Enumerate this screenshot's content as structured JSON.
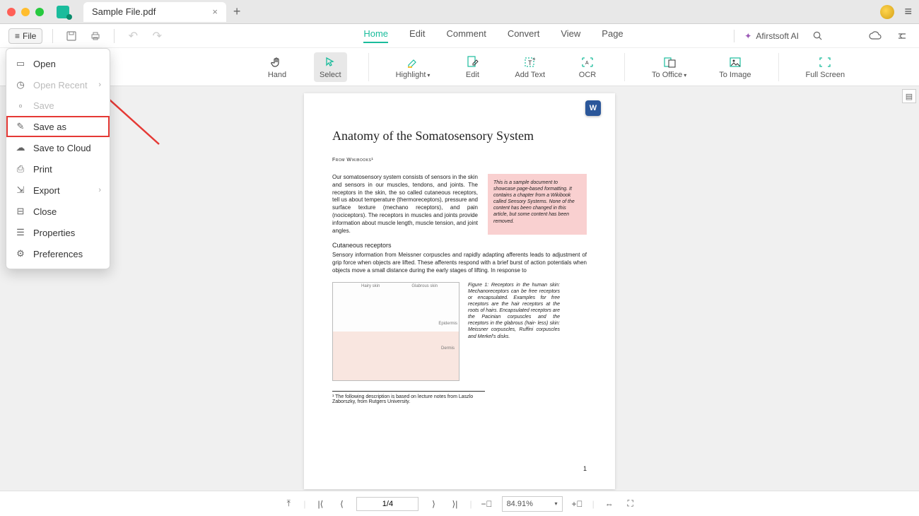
{
  "titlebar": {
    "tab_title": "Sample File.pdf"
  },
  "toolbar": {
    "file_label": "File"
  },
  "tabs": {
    "home": "Home",
    "edit": "Edit",
    "comment": "Comment",
    "convert": "Convert",
    "view": "View",
    "page": "Page"
  },
  "ai": {
    "label": "Afirstsoft AI"
  },
  "ribbon": {
    "hand": "Hand",
    "select": "Select",
    "highlight": "Highlight",
    "edit": "Edit",
    "add_text": "Add Text",
    "ocr": "OCR",
    "to_office": "To Office",
    "to_image": "To Image",
    "full_screen": "Full Screen"
  },
  "file_menu": {
    "open": "Open",
    "open_recent": "Open Recent",
    "save": "Save",
    "save_as": "Save as",
    "save_cloud": "Save to Cloud",
    "print": "Print",
    "export": "Export",
    "close": "Close",
    "properties": "Properties",
    "preferences": "Preferences"
  },
  "doc": {
    "title": "Anatomy of the Somatosensory System",
    "subtitle": "From Wikibooks¹",
    "para1": "Our somatosensory system consists of sensors in the skin and sensors in our muscles, tendons, and joints. The receptors in the skin, the so called cutaneous receptors, tell us about temperature (thermoreceptors), pressure and surface texture (mechano receptors), and pain (nociceptors). The receptors in muscles and joints provide information about muscle length, muscle tension, and joint angles.",
    "sidebar": "This is a sample document to showcase page-based formatting. It contains a chapter from a Wikibook called Sensory Systems. None of the content has been changed in this article, but some content has been removed.",
    "heading2": "Cutaneous receptors",
    "para2": "Sensory information from Meissner corpuscles and rapidly adapting afferents leads to adjustment of grip force when objects are lifted. These afferents respond with a brief burst of action potentials when objects move a small distance during the early stages of lifting. In response to",
    "figcap": "Figure 1: Receptors in the human skin: Mechanoreceptors can be free receptors or encapsulated. Examples for free receptors are the hair receptors at the roots of hairs. Encapsulated receptors are the Pacinian corpuscles and the receptors in the glabrous (hair- less) skin: Meissner corpuscles, Ruffini corpuscles and Merkel's disks.",
    "footnote": "¹ The following description is based on lecture notes from Laszlo Zaborszky, from Rutgers University.",
    "pagenum": "1"
  },
  "status": {
    "page": "1/4",
    "zoom": "84.91%"
  }
}
